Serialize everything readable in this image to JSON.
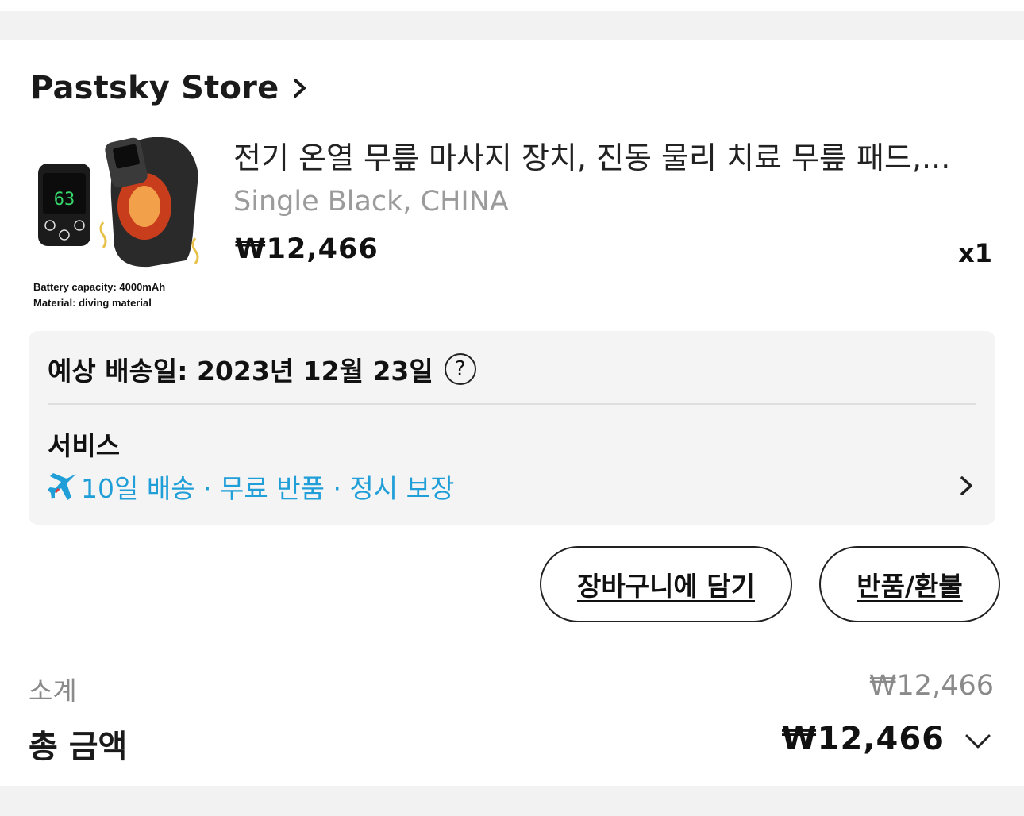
{
  "store": {
    "name": "Pastsky Store"
  },
  "product": {
    "title": "전기 온열 무릎 마사지 장치, 진동 물리 치료 무릎 패드,...",
    "variant": "Single Black, CHINA",
    "price": "₩12,466",
    "quantity": "x1",
    "image": {
      "display_value": "63",
      "caption_line1": "Battery capacity: 4000mAh",
      "caption_line2": "Material: diving material"
    }
  },
  "delivery": {
    "label": "예상 배송일: 2023년 12월 23일",
    "help_icon": "?"
  },
  "services": {
    "label": "서비스",
    "text": "10일 배송 · 무료 반품 · 정시 보장",
    "icon": "airplane-icon",
    "icon_color": "#1f9ed8"
  },
  "actions": {
    "add_to_cart": "장바구니에 담기",
    "return_refund": "반품/환불"
  },
  "summary": {
    "subtotal_label": "소계",
    "subtotal_value": "₩12,466",
    "total_label": "총 금액",
    "total_value": "₩12,466"
  }
}
